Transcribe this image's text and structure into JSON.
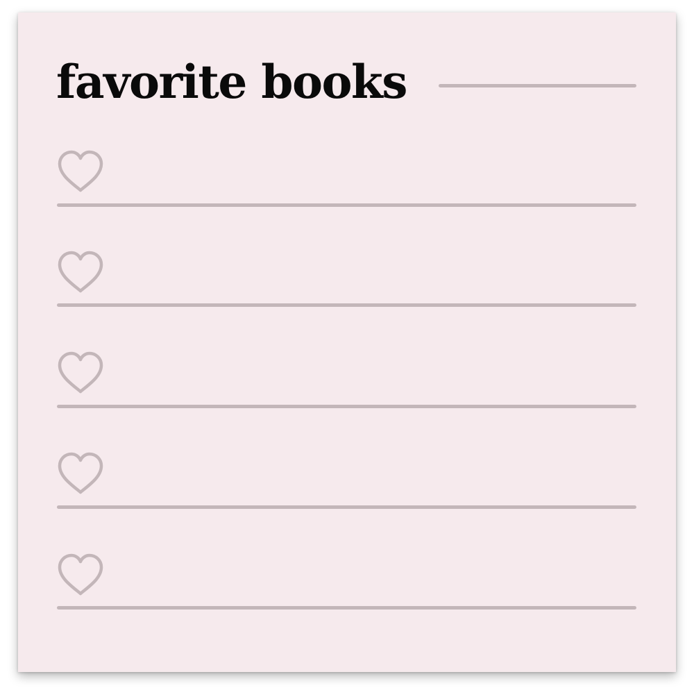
{
  "title": "favorite books",
  "colors": {
    "card_background": "#f6eaed",
    "rule_color": "#c3b6b9",
    "heart_stroke": "#c3b6b9",
    "title_color": "#0a0a0a"
  },
  "rows": [
    {
      "icon": "heart-outline-icon",
      "entry": ""
    },
    {
      "icon": "heart-outline-icon",
      "entry": ""
    },
    {
      "icon": "heart-outline-icon",
      "entry": ""
    },
    {
      "icon": "heart-outline-icon",
      "entry": ""
    },
    {
      "icon": "heart-outline-icon",
      "entry": ""
    }
  ]
}
